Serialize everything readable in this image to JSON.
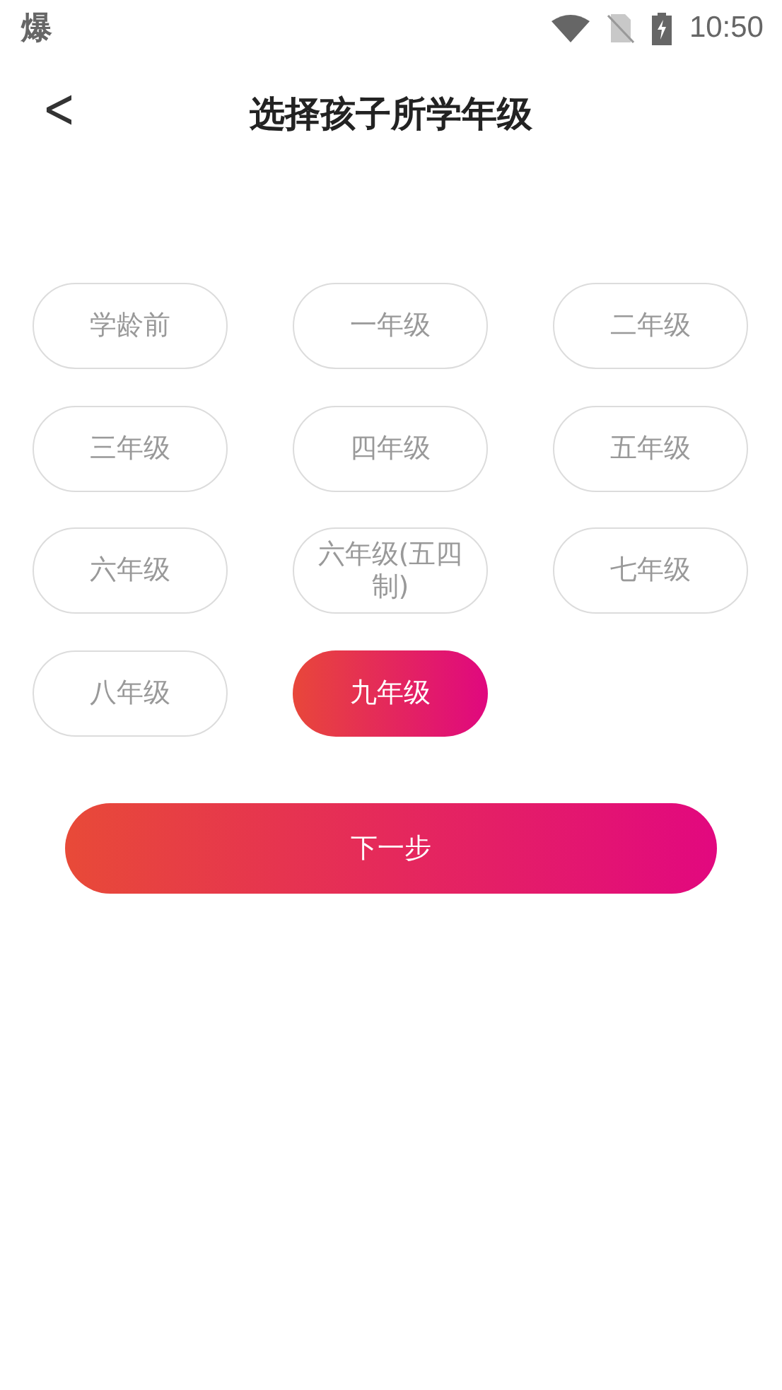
{
  "status_bar": {
    "notification": "爆",
    "time": "10:50"
  },
  "header": {
    "back": "<",
    "title": "选择孩子所学年级"
  },
  "grades": [
    {
      "label": "学龄前",
      "selected": false
    },
    {
      "label": "一年级",
      "selected": false
    },
    {
      "label": "二年级",
      "selected": false
    },
    {
      "label": "三年级",
      "selected": false
    },
    {
      "label": "四年级",
      "selected": false
    },
    {
      "label": "五年级",
      "selected": false
    },
    {
      "label": "六年级",
      "selected": false
    },
    {
      "label": "六年级(五四制)",
      "selected": false
    },
    {
      "label": "七年级",
      "selected": false
    },
    {
      "label": "八年级",
      "selected": false
    },
    {
      "label": "九年级",
      "selected": true
    }
  ],
  "next_button": "下一步"
}
